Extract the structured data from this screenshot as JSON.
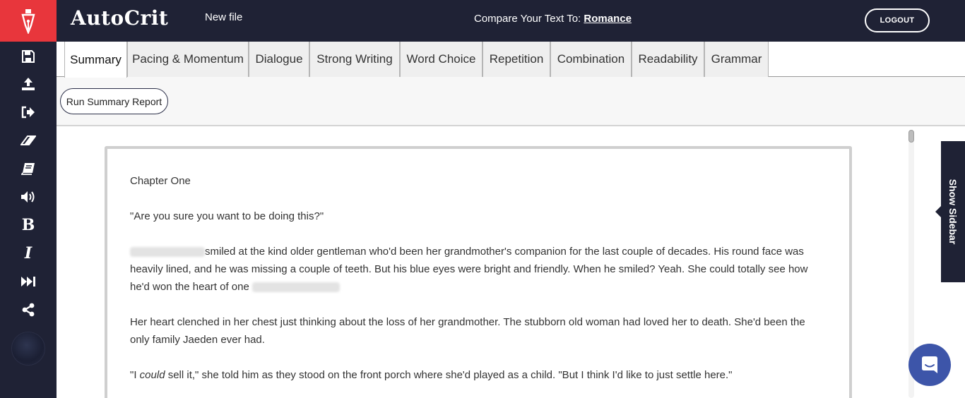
{
  "app": {
    "brand": "AutoCrit",
    "file_name": "New file",
    "compare_label": "Compare Your Text To:",
    "compare_genre": "Romance",
    "logout_label": "LOGOUT"
  },
  "rail": {
    "icons": [
      "pen-nib-icon",
      "save-icon",
      "upload-icon",
      "export-icon",
      "eraser-icon",
      "book-icon",
      "speaker-icon",
      "bold-icon",
      "italic-icon",
      "fast-forward-icon",
      "share-icon"
    ],
    "bold_glyph": "B",
    "italic_glyph": "I"
  },
  "tabs": [
    {
      "label": "Summary",
      "active": true
    },
    {
      "label": "Pacing & Momentum",
      "active": false
    },
    {
      "label": "Dialogue",
      "active": false
    },
    {
      "label": "Strong Writing",
      "active": false
    },
    {
      "label": "Word Choice",
      "active": false
    },
    {
      "label": "Repetition",
      "active": false
    },
    {
      "label": "Combination",
      "active": false
    },
    {
      "label": "Readability",
      "active": false
    },
    {
      "label": "Grammar",
      "active": false
    }
  ],
  "toolbar": {
    "run_label": "Run Summary Report"
  },
  "document": {
    "heading": "Chapter One",
    "p1": "\"Are you sure you want to be doing this?\"",
    "p2_text": "smiled at the kind older gentleman who'd been her grandmother's companion for the last couple of decades. His round face was heavily lined, and he was missing a couple of teeth. But his blue eyes were bright and friendly. When he smiled? Yeah. She could totally see how he'd won the heart of one",
    "p3": "Her heart clenched in her chest just thinking about the loss of her grandmother. The stubborn old woman had loved her to death. She'd been the only family Jaeden ever had.",
    "p4_a": "\"I ",
    "p4_em": "could",
    "p4_b": " sell it,\" she told him as they stood on the front porch where she'd played as a child. \"But I think I'd like to just settle here.\""
  },
  "sidebar_toggle": {
    "label": "Show Sidebar"
  },
  "colors": {
    "navy": "#1f2235",
    "accent_red": "#e8363c",
    "chat_blue": "#3d55a9"
  }
}
